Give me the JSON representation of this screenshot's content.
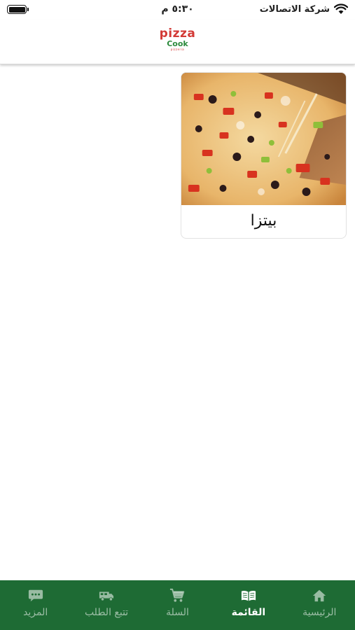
{
  "status_bar": {
    "carrier": "شركة الاتصالات",
    "time": "٥:٣٠ م"
  },
  "header": {
    "logo_line1": "pizza",
    "logo_line2": "Cook",
    "logo_line3": "pizzeria"
  },
  "categories": [
    {
      "label": "بيتزا",
      "image_icon": "pizza-photo"
    }
  ],
  "bottom_nav": {
    "active": "menu",
    "items": [
      {
        "key": "home",
        "label": "الرئيسية",
        "icon": "home-icon"
      },
      {
        "key": "menu",
        "label": "القائمة",
        "icon": "book-icon"
      },
      {
        "key": "cart",
        "label": "السلة",
        "icon": "cart-icon"
      },
      {
        "key": "track",
        "label": "تتبع الطلب",
        "icon": "truck-icon"
      },
      {
        "key": "more",
        "label": "المزيد",
        "icon": "chat-icon"
      }
    ]
  },
  "colors": {
    "nav_background": "#1e6b34",
    "logo_red": "#d33a36",
    "logo_green": "#2c8a3c"
  }
}
